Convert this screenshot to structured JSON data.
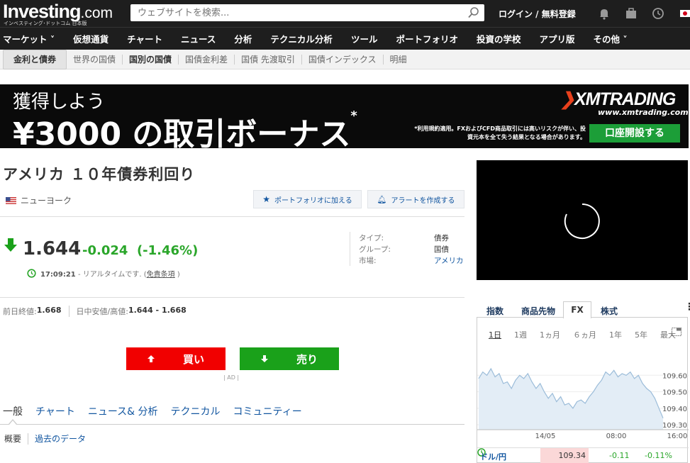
{
  "header": {
    "logo_main": "Investing",
    "logo_suffix": ".com",
    "logo_sub": "インベスティング･ドットコム 日本版",
    "search_placeholder": "ウェブサイトを検索...",
    "login": "ログイン / 無料登録",
    "icons": [
      "bell-icon",
      "briefcase-icon",
      "clock-icon",
      "japan-flag-icon"
    ]
  },
  "nav": {
    "items": [
      "マーケット ˅",
      "仮想通貨",
      "チャート",
      "ニュース",
      "分析",
      "テクニカル分析",
      "ツール",
      "ポートフォリオ",
      "投資の学校",
      "アプリ版",
      "その他 ˅"
    ]
  },
  "subnav": {
    "items": [
      "金利と債券",
      "世界の国債",
      "国別の国債",
      "国債金利差",
      "国債 先渡取引",
      "国債インデックス",
      "明細"
    ]
  },
  "banner": {
    "line1": "獲得しよう",
    "line2": "¥3000 の取引ボーナス",
    "line2_mark": "*",
    "brand": "XMTRADING",
    "url": "www.xmtrading.com",
    "note": "*利用規約適用。FXおよびCFD商品取引には高いリスクが伴い、投資元本を全て失う結果となる場合があります。",
    "cta": "口座開設する"
  },
  "instrument": {
    "title": "アメリカ １０年債券利回り",
    "location": "ニューヨーク",
    "add_portfolio": "ポートフォリオに加える",
    "create_alert": "アラートを作成する",
    "price": "1.644",
    "change": "-0.024",
    "change_pct": "(-1.46%)",
    "time": "17:09:21",
    "realtime_text": "- リアルタイムです. (",
    "disclaimer": "免責条項",
    "close_paren": " )",
    "meta": [
      {
        "key": "タイプ:",
        "value": "債券"
      },
      {
        "key": "グループ:",
        "value": "国債"
      },
      {
        "key": "市場:",
        "value": "アメリカ"
      }
    ],
    "prev_close_label": "前日終値: ",
    "prev_close": "1.668",
    "day_range_label": "日中安値/高値: ",
    "day_range": "1.644 - 1.668"
  },
  "trade": {
    "buy": "買い",
    "sell": "売り",
    "ad_label": "| AD |"
  },
  "tabs": [
    "一般",
    "チャート",
    "ニュース& 分析",
    "テクニカル",
    "コミュニティー"
  ],
  "subtabs": [
    "概要",
    "過去のデータ"
  ],
  "widget": {
    "tabs": [
      "指数",
      "商品先物",
      "FX",
      "株式"
    ],
    "periods": [
      "1日",
      "1週",
      "1ヵ月",
      "６ヵ月",
      "1年",
      "5年",
      "最大"
    ],
    "pair": "ドル/円",
    "pair_price": "109.34",
    "pair_change": "-0.11",
    "pair_pct": "-0.11%",
    "colors": {
      "line": "#9bbcd9",
      "fill": "#e3edf6",
      "up": "#2aa62a",
      "down": "#f10000"
    }
  },
  "chart_data": {
    "type": "area",
    "x_ticks": [
      "14/05",
      "08:00",
      "16:00"
    ],
    "y_ticks": [
      109.6,
      109.5,
      109.4,
      109.3
    ],
    "ylim": [
      109.27,
      109.7
    ],
    "values": [
      109.58,
      109.62,
      109.6,
      109.64,
      109.59,
      109.61,
      109.55,
      109.56,
      109.52,
      109.57,
      109.6,
      109.58,
      109.61,
      109.56,
      109.52,
      109.55,
      109.5,
      109.46,
      109.49,
      109.44,
      109.47,
      109.42,
      109.43,
      109.4,
      109.44,
      109.45,
      109.43,
      109.47,
      109.5,
      109.54,
      109.57,
      109.62,
      109.6,
      109.63,
      109.59,
      109.61,
      109.6,
      109.62,
      109.58,
      109.6,
      109.55,
      109.52,
      109.5,
      109.46,
      109.4,
      109.34
    ]
  }
}
